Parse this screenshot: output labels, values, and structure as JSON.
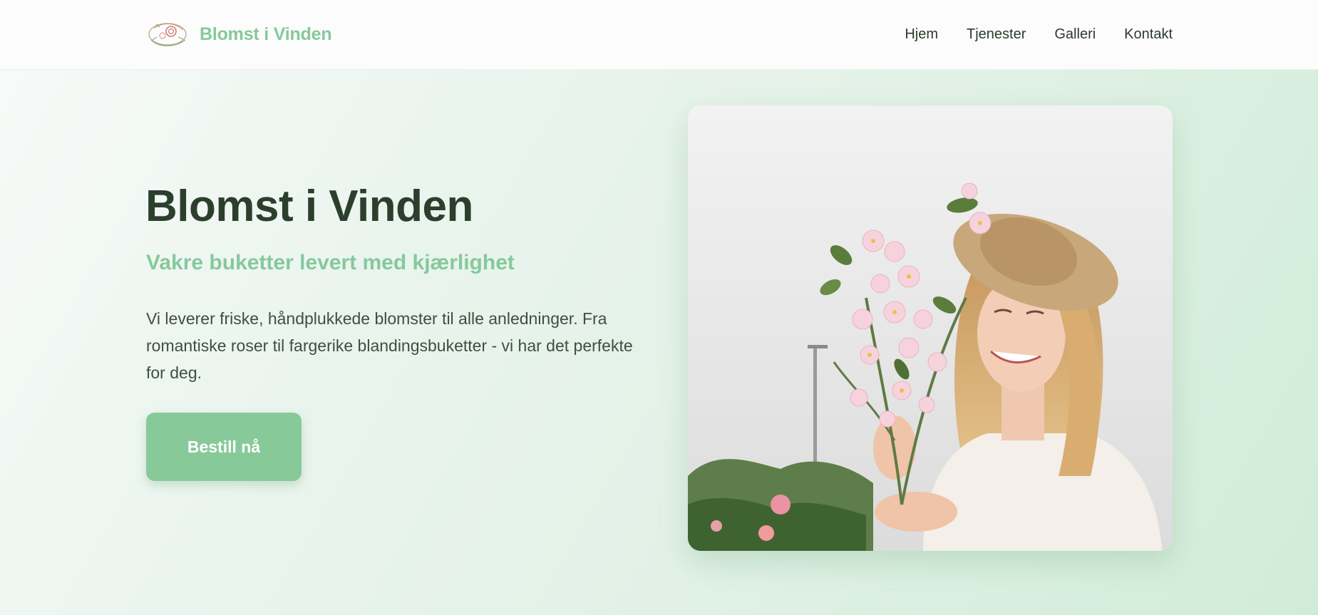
{
  "header": {
    "brand_name": "Blomst i Vinden",
    "logo_icon": "floral-wreath-logo",
    "nav": [
      {
        "label": "Hjem"
      },
      {
        "label": "Tjenester"
      },
      {
        "label": "Galleri"
      },
      {
        "label": "Kontakt"
      }
    ]
  },
  "hero": {
    "title": "Blomst i Vinden",
    "subtitle": "Vakre buketter levert med kjærlighet",
    "text": "Vi leverer friske, håndplukkede blomster til alle anledninger. Fra romantiske roser til fargerike blandingsbuketter - vi har det perfekte for deg.",
    "cta_label": "Bestill nå",
    "image": "woman-with-flowers-photo"
  },
  "colors": {
    "accent_green": "#86c99b",
    "button_green": "#88c99a",
    "title_dark": "#2c3e2c",
    "body_text": "#3f4f3f"
  }
}
